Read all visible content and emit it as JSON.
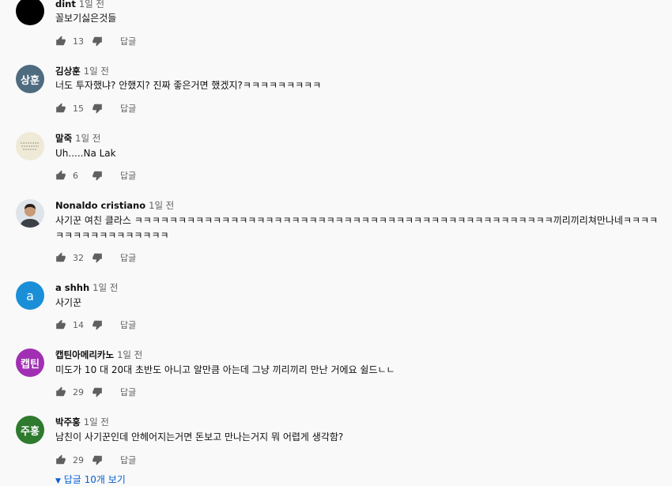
{
  "reply_label": "답글",
  "comments": [
    {
      "author": "dint",
      "time": "1일 전",
      "text": "꼴보기싫은것들",
      "likes": "13",
      "avatar_text": "",
      "avatar_color": "#000000"
    },
    {
      "author": "김상훈",
      "time": "1일 전",
      "text": "너도 투자했냐? 안했지? 진짜 좋은거면 했겠지?ㅋㅋㅋㅋㅋㅋㅋㅋㅋ",
      "likes": "15",
      "avatar_text": "상훈",
      "avatar_color": "#4e6b80"
    },
    {
      "author": "말죽",
      "time": "1일 전",
      "text": "Uh.....Na Lak",
      "likes": "6",
      "avatar_text": "",
      "avatar_color": "#efe9d8"
    },
    {
      "author": "Nonaldo cristiano",
      "time": "1일 전",
      "text": "사기꾼 여친 클라스 ㅋㅋㅋㅋㅋㅋㅋㅋㅋㅋㅋㅋㅋㅋㅋㅋㅋㅋㅋㅋㅋㅋㅋㅋㅋㅋㅋㅋㅋㅋㅋㅋㅋㅋㅋㅋㅋㅋㅋㅋㅋㅋㅋㅋㅋㅋㅋㅋ끼리끼리쳐만나네ㅋㅋㅋㅋㅋㅋㅋㅋㅋㅋㅋㅋㅋㅋㅋㅋㅋ",
      "likes": "32",
      "avatar_text": "",
      "avatar_color": "#dfe4ea"
    },
    {
      "author": "a shhh",
      "time": "1일 전",
      "text": "사기꾼",
      "likes": "14",
      "avatar_text": "a",
      "avatar_color": "#1a8fd8"
    },
    {
      "author": "캡틴아메리카노",
      "time": "1일 전",
      "text": "미도가 10 대 20대 초반도 아니고 알만큼 아는데 그냥 끼리끼리 만난 거에요 쉴드ㄴㄴ",
      "likes": "29",
      "avatar_text": "캡틴",
      "avatar_color": "#a12fb3"
    },
    {
      "author": "박주홍",
      "time": "1일 전",
      "text": "남친이 사기꾼인데 안헤어지는거면 돈보고 만나는거지 뭐 어렵게 생각함?",
      "likes": "29",
      "avatar_text": "주홍",
      "avatar_color": "#2e7a2e"
    }
  ],
  "more_replies": "답글 10개 보기"
}
